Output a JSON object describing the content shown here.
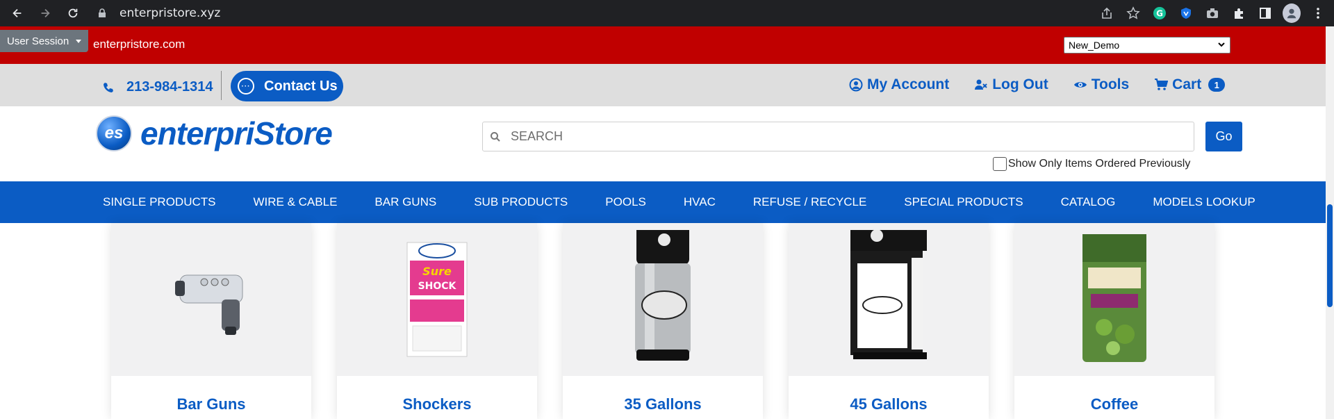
{
  "browser": {
    "url": "enterpristore.xyz"
  },
  "session_bar": {
    "session_label": "User Session",
    "domain": "enterpristore.com",
    "selected_demo": "New_Demo"
  },
  "utility": {
    "phone": "213-984-1314",
    "contact_label": "Contact Us",
    "my_account": "My Account",
    "log_out": "Log Out",
    "tools": "Tools",
    "cart": "Cart",
    "cart_count": "1"
  },
  "header": {
    "logo_badge": "es",
    "logo_text": "enterpriStore",
    "search_placeholder": "SEARCH",
    "go_label": "Go",
    "prev_items_label": "Show Only Items Ordered Previously"
  },
  "nav": [
    "SINGLE PRODUCTS",
    "WIRE & CABLE",
    "BAR GUNS",
    "SUB PRODUCTS",
    "POOLS",
    "HVAC",
    "REFUSE / RECYCLE",
    "SPECIAL PRODUCTS",
    "CATALOG",
    "MODELS LOOKUP"
  ],
  "products": [
    {
      "title": "Bar Guns"
    },
    {
      "title": "Shockers"
    },
    {
      "title": "35 Gallons"
    },
    {
      "title": "45 Gallons"
    },
    {
      "title": "Coffee"
    }
  ],
  "colors": {
    "brand_blue": "#0b5cc4",
    "session_red": "#c00000",
    "utility_grey": "#dedede"
  }
}
